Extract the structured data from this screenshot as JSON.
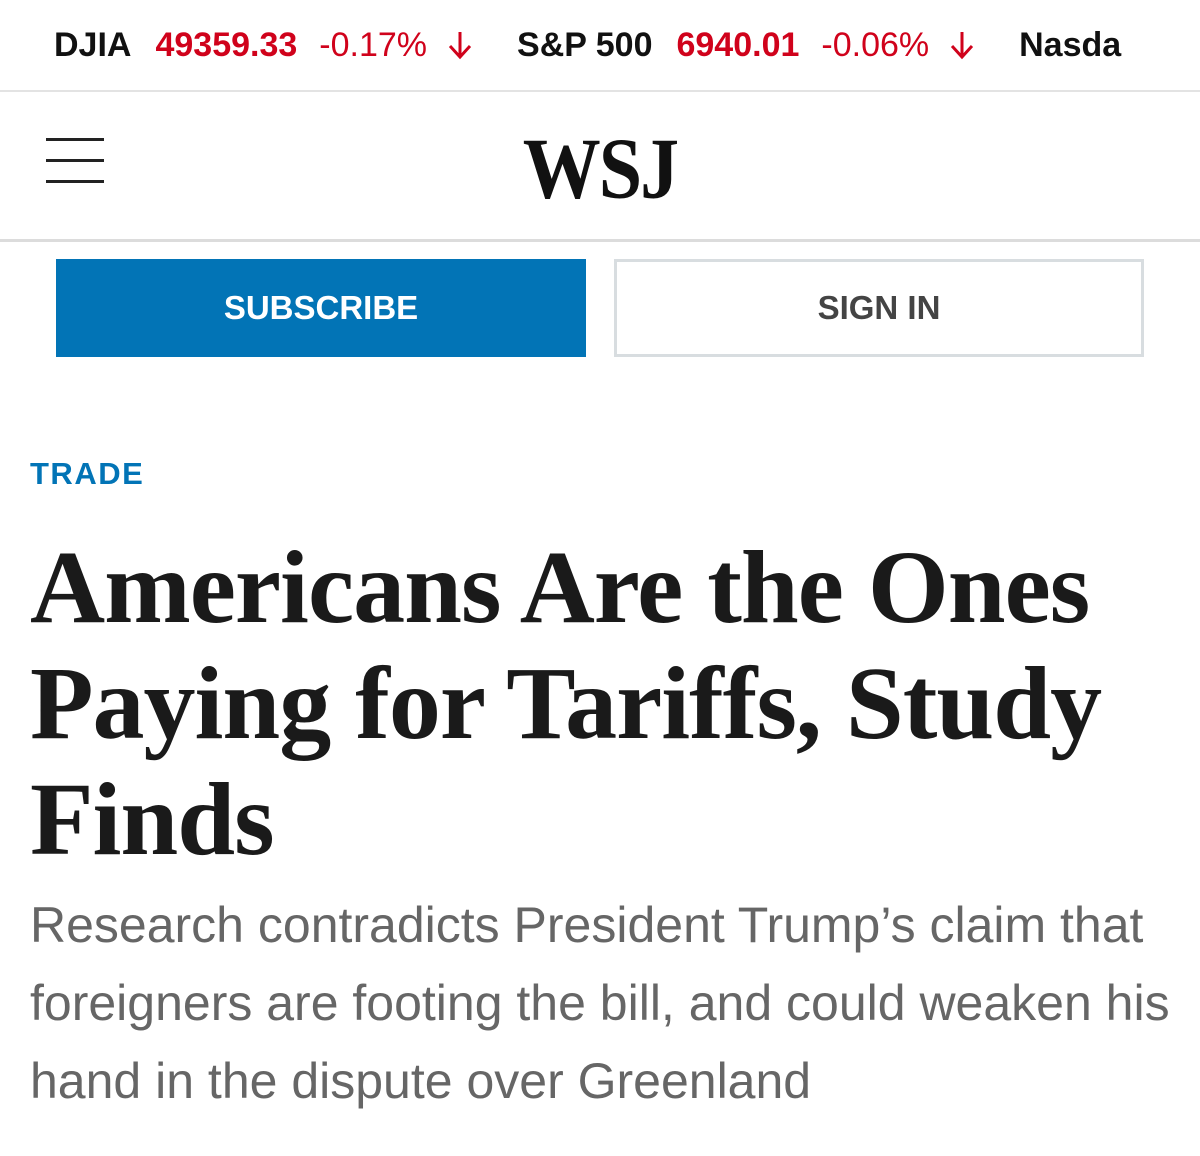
{
  "ticker": [
    {
      "name": "DJIA",
      "value": "49359.33",
      "change": "-0.17%",
      "direction": "down"
    },
    {
      "name": "S&P 500",
      "value": "6940.01",
      "change": "-0.06%",
      "direction": "down"
    },
    {
      "name": "Nasda",
      "value": "",
      "change": "",
      "direction": ""
    }
  ],
  "header": {
    "menu_icon": "hamburger-menu-icon",
    "logo": "WSJ"
  },
  "auth": {
    "subscribe_label": "SUBSCRIBE",
    "signin_label": "SIGN IN"
  },
  "article": {
    "section": "TRADE",
    "headline": "Americans Are the Ones Paying for Tariffs, Study Finds",
    "dek": "Research contradicts President Trump’s claim that foreigners are footing the bill, and could weaken his hand in the dispute over Greenland"
  },
  "colors": {
    "accent": "#0274b6",
    "negative": "#d0021b"
  }
}
